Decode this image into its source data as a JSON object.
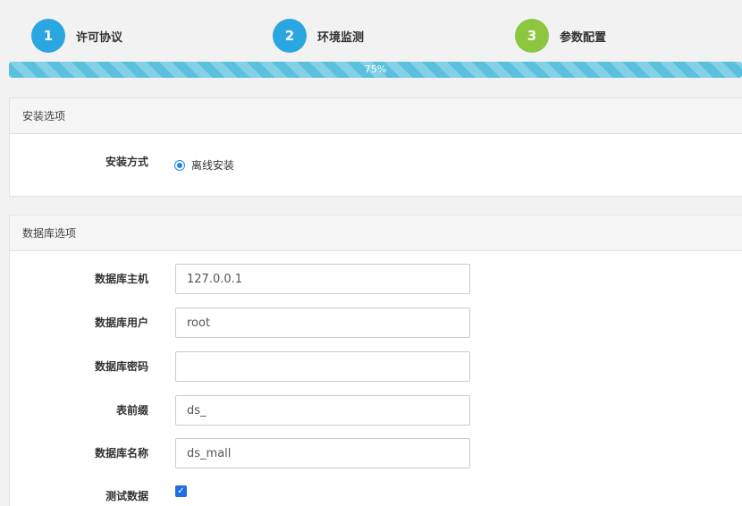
{
  "steps": [
    {
      "number": "1",
      "label": "许可协议",
      "color": "#2aa6e0"
    },
    {
      "number": "2",
      "label": "环境监测",
      "color": "#2aa6e0"
    },
    {
      "number": "3",
      "label": "参数配置",
      "color": "#8cc63f"
    }
  ],
  "progress": {
    "value": 0.75,
    "text": "75%",
    "color": "#5bc0de"
  },
  "install_panel": {
    "title": "安装选项",
    "method_label": "安装方式",
    "method_option": "离线安装",
    "method_selected": true
  },
  "db_panel": {
    "title": "数据库选项",
    "fields": [
      {
        "label": "数据库主机",
        "value": "127.0.0.1"
      },
      {
        "label": "数据库用户",
        "value": "root"
      },
      {
        "label": "数据库密码",
        "value": ""
      },
      {
        "label": "表前缀",
        "value": "ds_"
      },
      {
        "label": "数据库名称",
        "value": "ds_mall"
      }
    ],
    "test_data_label": "测试数据",
    "test_data_checked": true
  },
  "accent_color": "#1e88e5"
}
